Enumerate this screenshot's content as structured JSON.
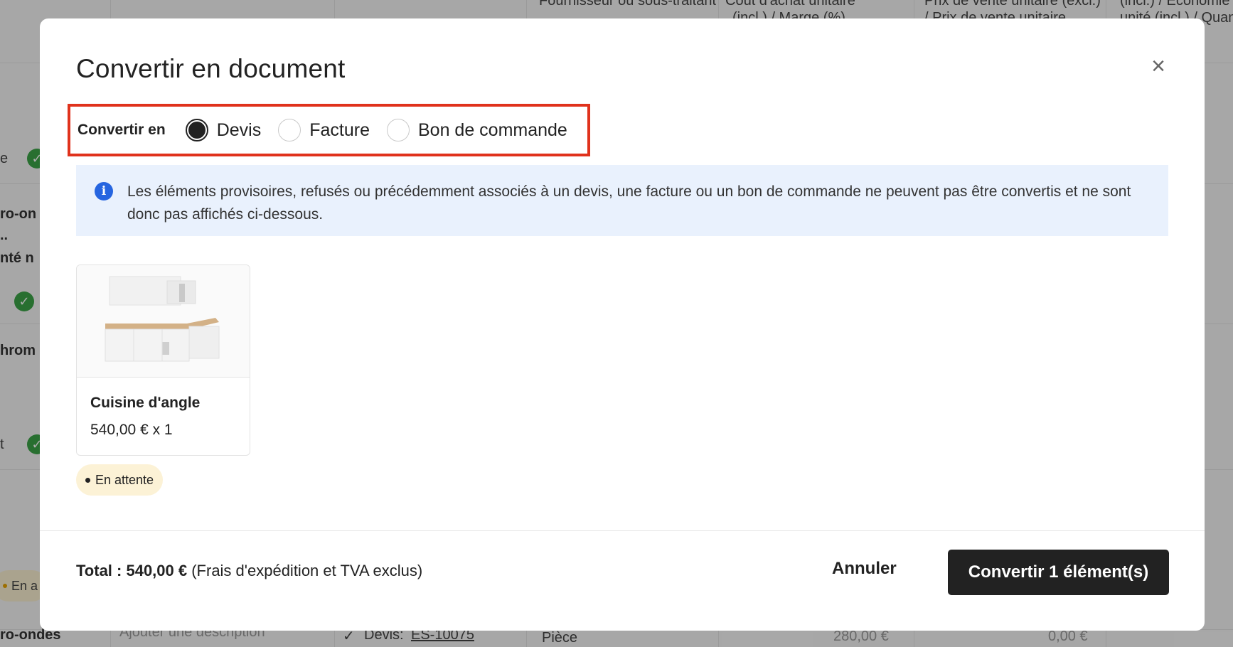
{
  "background": {
    "header_fragments": [
      "Fournisseur ou sous-traitant",
      "Coût d'achat unitaire",
      "(incl.) / Marge (%)",
      "Prix de vente unitaire (excl.)",
      "/ Prix de vente unitaire",
      "(incl.) / Economie",
      "unité (incl.) / Quan"
    ],
    "row_fragments": [
      "e",
      "ro-on",
      "..",
      "nté n",
      "hrom",
      "t",
      "En a",
      "ro-ondes"
    ],
    "bottom_row": {
      "description_placeholder": "Ajouter une description",
      "devis_label": "Devis:",
      "devis_ref": "ES-10075",
      "unit": "Pièce",
      "price": "280,00 €",
      "discount": "0,00 €"
    }
  },
  "modal": {
    "title": "Convertir en document",
    "close_icon": "×",
    "convert": {
      "label": "Convertir en",
      "options": [
        {
          "label": "Devis",
          "checked": true
        },
        {
          "label": "Facture",
          "checked": false
        },
        {
          "label": "Bon de commande",
          "checked": false
        }
      ]
    },
    "info": {
      "icon": "i",
      "text": "Les éléments provisoires, refusés ou précédemment associés à un devis, une facture ou un bon de commande ne peuvent pas être convertis et ne sont donc pas affichés ci-dessous."
    },
    "product": {
      "name": "Cuisine d'angle",
      "price": "540,00 € x 1",
      "status": "En attente"
    },
    "footer": {
      "total_label": "Total : 540,00 €",
      "total_note": " (Frais d'expédition et TVA exclus)",
      "cancel_label": "Annuler",
      "convert_label": "Convertir 1 élément(s)"
    }
  },
  "colors": {
    "highlight_border": "#e0321c",
    "info_bg": "#e9f1fd",
    "info_icon": "#2665e0",
    "primary_button": "#222222",
    "status_badge_bg": "#fcf2d6",
    "check_green": "#3ca447"
  }
}
